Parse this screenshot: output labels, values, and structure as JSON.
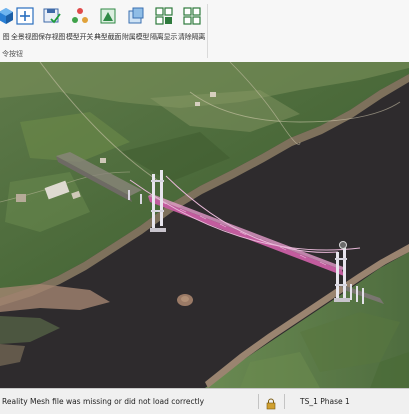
{
  "toolbar": {
    "buttons": [
      {
        "label": "图",
        "icon": "cube-icon"
      },
      {
        "label": "全景视图",
        "icon": "fit-view-icon"
      },
      {
        "label": "保存视图",
        "icon": "save-view-icon"
      },
      {
        "label": "模型开关",
        "icon": "model-toggle-icon"
      },
      {
        "label": "典型截面",
        "icon": "section-icon"
      },
      {
        "label": "附属模型",
        "icon": "attached-model-icon"
      },
      {
        "label": "隔离显示",
        "icon": "isolate-icon"
      },
      {
        "label": "清除隔离",
        "icon": "clear-isolate-icon"
      }
    ],
    "group_label": "令按钮"
  },
  "status": {
    "message": "Reality Mesh file was missing or did not load correctly",
    "stage": "TS_1 Phase 1"
  },
  "colors": {
    "ribbon_bg": "#f7f7f7",
    "water": "#2e2b2d",
    "bridge_deck": "#d46fb0",
    "tower": "#e8e6ee"
  }
}
